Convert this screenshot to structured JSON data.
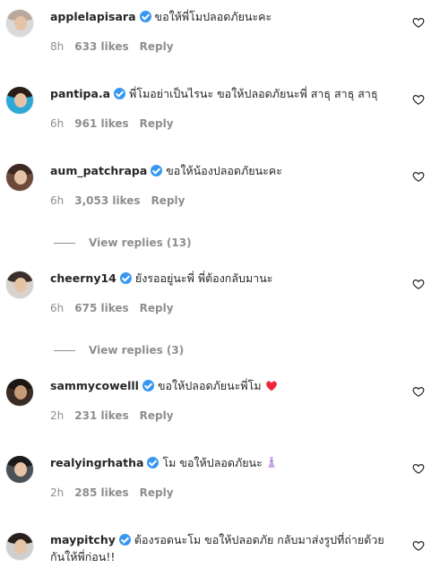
{
  "comments": [
    {
      "username": "applelapisara",
      "text": "ขอให้พี่โมปลอดภัยนะคะ",
      "text2": "",
      "emoji": "",
      "time": "8h",
      "likes": "633 likes",
      "reply": "Reply",
      "avatar_colors": [
        "#d9d9d9",
        "#b9a99c"
      ]
    },
    {
      "username": "pantipa.a",
      "text": "พี่โมอย่าเป็นไรนะ ขอให้ปลอดภัยนะพี่ สาธุ สาธุ สาธุ",
      "text2": "",
      "emoji": "",
      "time": "6h",
      "likes": "961 likes",
      "reply": "Reply",
      "avatar_colors": [
        "#2fa8d8",
        "#2a1c17"
      ]
    },
    {
      "username": "aum_patchrapa",
      "text": "ขอให้น้องปลอดภัยนะคะ",
      "text2": "",
      "emoji": "",
      "time": "6h",
      "likes": "3,053 likes",
      "reply": "Reply",
      "avatar_colors": [
        "#6b4a3a",
        "#3a2a22"
      ]
    },
    {
      "username": "cheerny14",
      "text": "ยังรออยู่นะพี่ พี่ต้องกลับมานะ",
      "text2": "",
      "emoji": "",
      "time": "6h",
      "likes": "675 likes",
      "reply": "Reply",
      "avatar_colors": [
        "#d8d2cc",
        "#3b2f2b"
      ]
    },
    {
      "username": "sammycowelll",
      "text": "ขอให้ปลอดภัยนะพี่โม",
      "text2": "",
      "emoji": "red-heart",
      "time": "2h",
      "likes": "231 likes",
      "reply": "Reply",
      "avatar_colors": [
        "#3b2b25",
        "#1e1613"
      ]
    },
    {
      "username": "realyingrhatha",
      "text": "โม ขอให้ปลอดภัยนะ",
      "text2": "",
      "emoji": "dress",
      "time": "2h",
      "likes": "285 likes",
      "reply": "Reply",
      "avatar_colors": [
        "#4a5258",
        "#1c1a1a"
      ]
    },
    {
      "username": "maypitchy",
      "text": "ต้องรอดนะโม ขอให้ปลอดภัย กลับมาส่งรูปที่ถ่ายด้วย",
      "text2": "กันให้พี่ก่อน!!",
      "emoji": "",
      "time": "",
      "likes": "",
      "reply": "",
      "avatar_colors": [
        "#cfcfcf",
        "#2a1f1c"
      ]
    }
  ],
  "view_replies": [
    {
      "label": "View replies (13)"
    },
    {
      "label": "View replies (3)"
    }
  ],
  "icons": {
    "heart": "heart-outline-icon",
    "verified": "verified-badge-icon"
  },
  "colors": {
    "verified": "#3897f0",
    "meta": "#8e8e8e",
    "red_heart": "#ed2939"
  }
}
